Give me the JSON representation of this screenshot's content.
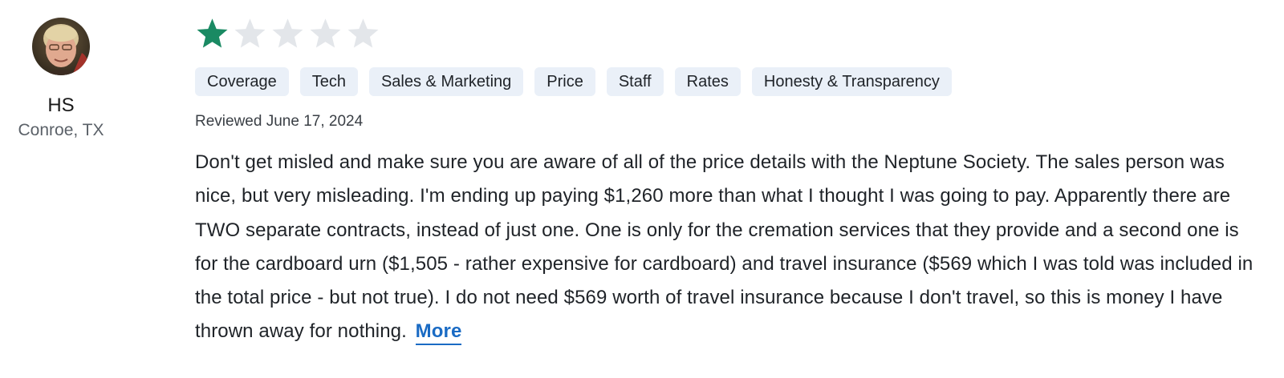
{
  "author": {
    "name": "HS",
    "location": "Conroe, TX"
  },
  "rating": {
    "value": 1,
    "max": 5,
    "filled_color": "#1a8a63",
    "empty_color": "#e3e6ea"
  },
  "tags": [
    "Coverage",
    "Tech",
    "Sales & Marketing",
    "Price",
    "Staff",
    "Rates",
    "Honesty & Transparency"
  ],
  "review": {
    "date": "Reviewed June 17, 2024",
    "body": "Don't get misled and make sure you are aware of all of the price details with the Neptune Society. The sales person was nice, but very misleading. I'm ending up paying $1,260 more than what I thought I was going to pay. Apparently there are TWO separate contracts, instead of just one. One is only for the cremation services that they provide and a second one is for the cardboard urn ($1,505 - rather expensive for cardboard) and travel insurance ($569 which I was told was included in the total price - but not true). I do not need $569 worth of travel insurance because I don't travel, so this is money I have thrown away for nothing.",
    "more_label": "More"
  },
  "colors": {
    "accent": "#1a6bc4",
    "tag_bg": "#eaf0f8"
  }
}
